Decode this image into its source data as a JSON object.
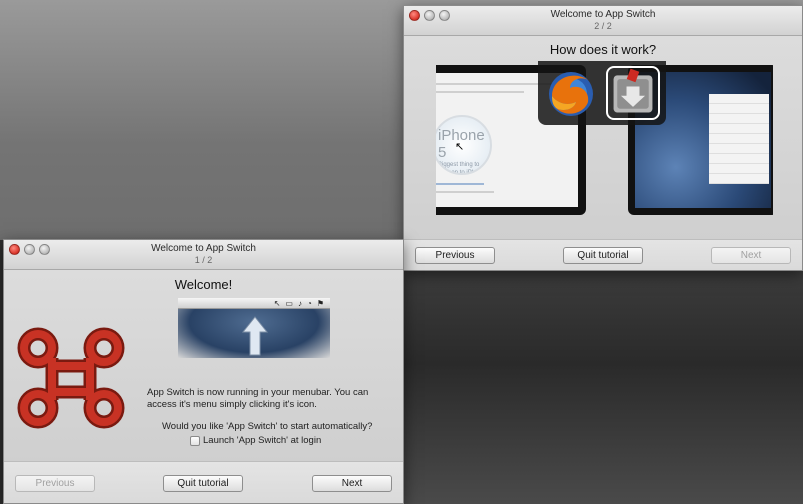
{
  "window_tutorial_step2": {
    "title": "Welcome to App Switch",
    "step": "2 / 2",
    "heading": "How does it work?",
    "magnifier_big": "iPhone 5",
    "magnifier_small": "Biggest thing to happen to iPhone since iPhone",
    "buttons": {
      "previous": "Previous",
      "quit": "Quit tutorial",
      "next": "Next"
    }
  },
  "window_tutorial_step1": {
    "title": "Welcome to App Switch",
    "step": "1 / 2",
    "heading": "Welcome!",
    "description": "App Switch is now running in your menubar. You can access it's menu simply clicking it's icon.",
    "question": "Would you like 'App Switch' to start automatically?",
    "launch_checkbox_label": "Launch 'App Switch' at login",
    "launch_checked": false,
    "buttons": {
      "previous": "Previous",
      "quit": "Quit tutorial",
      "next": "Next"
    }
  },
  "icons": {
    "close": "close-icon",
    "minimize": "minimize-icon",
    "zoom": "zoom-icon",
    "app_logo": "command-key-icon",
    "firefox": "firefox-icon",
    "transmit": "transmit-icon",
    "arrow": "up-arrow-icon"
  },
  "colors": {
    "close_red": "#d93328",
    "window_bg": "#dcdcdc",
    "logo_red": "#b3281c"
  }
}
